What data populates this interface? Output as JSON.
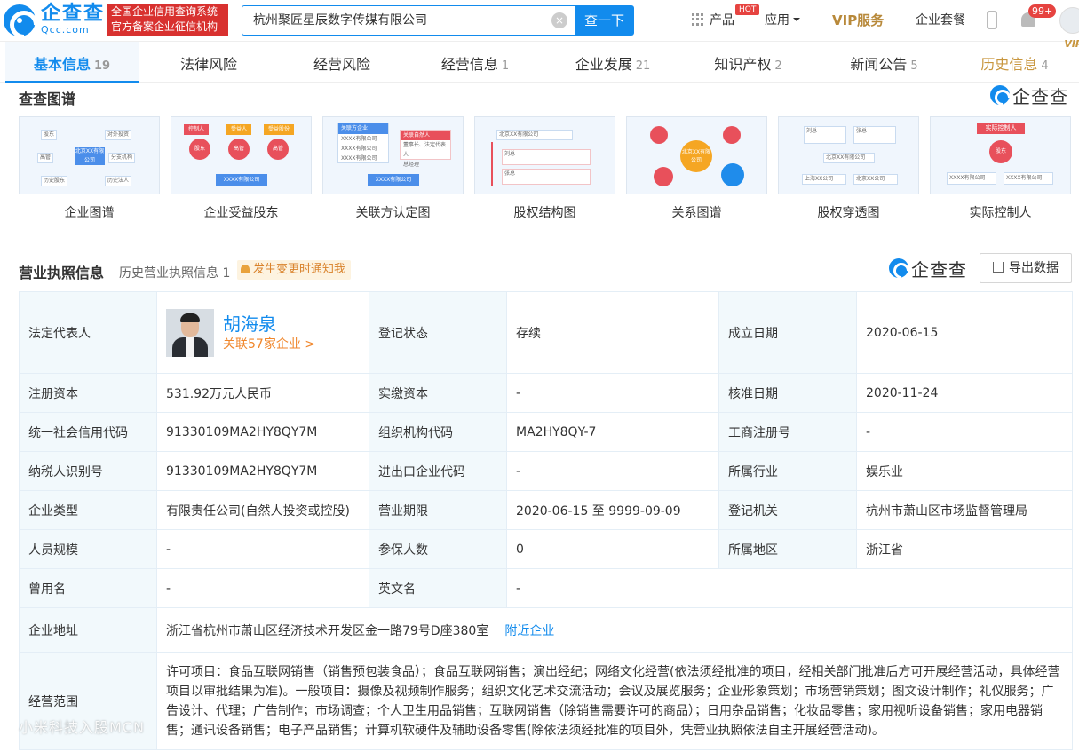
{
  "header": {
    "logo_cn": "企查查",
    "logo_en": "Qcc.com",
    "slogan_line1": "全国企业信用查询系统",
    "slogan_line2": "官方备案企业征信机构",
    "search_value": "杭州聚匠星辰数字传媒有限公司",
    "search_button": "查一下",
    "product": "产品",
    "hot": "HOT",
    "apps": "应用",
    "vip": "VIP服务",
    "package": "企业套餐",
    "notif_count": "99+"
  },
  "tabs": [
    {
      "label": "基本信息",
      "count": "19"
    },
    {
      "label": "法律风险",
      "count": ""
    },
    {
      "label": "经营风险",
      "count": ""
    },
    {
      "label": "经营信息",
      "count": "1"
    },
    {
      "label": "企业发展",
      "count": "21"
    },
    {
      "label": "知识产权",
      "count": "2"
    },
    {
      "label": "新闻公告",
      "count": "5"
    },
    {
      "label": "历史信息",
      "count": "4",
      "tag": "VIP"
    }
  ],
  "graph_section": {
    "title": "查查图谱",
    "brand": "企查查",
    "cards": [
      "企业图谱",
      "企业受益股东",
      "关联方认定图",
      "股权结构图",
      "关系图谱",
      "股权穿透图",
      "实际控制人"
    ],
    "card1": {
      "items": [
        "股东",
        "对外投资",
        "高管",
        "分支机构",
        "历史股东",
        "历史法人"
      ],
      "center": "北京XX有限公司"
    },
    "card2": {
      "tags": [
        "控制人",
        "受益人",
        "受益股份"
      ],
      "nodes": [
        "股东",
        "高管",
        "高管"
      ],
      "bottom": "XXXX有限公司"
    },
    "card3": {
      "left_title": "关联方企业",
      "left_items": [
        "XXXX有限公司",
        "XXXX有限公司",
        "XXXX有限公司"
      ],
      "right_title": "关联自然人",
      "right_items": [
        "董事长、法定代表人",
        "总经理"
      ],
      "bottom": "XXXX有限公司"
    },
    "card4": {
      "title": "北京XX有限公司",
      "rows": [
        "刘总",
        "张总"
      ]
    },
    "card5": {
      "center": "北京XX有限公司"
    },
    "card6": {
      "people": [
        "刘总",
        "张总"
      ],
      "center": "北京XX有限公司",
      "subs": [
        "上海XX公司",
        "北京XX公司"
      ]
    },
    "card7": {
      "title": "实际控制人",
      "node": "股东",
      "subs": [
        "XXXX有限公司",
        "XXXX有限公司"
      ]
    }
  },
  "license_section": {
    "title": "营业执照信息",
    "history_link": "历史营业执照信息 1",
    "notify": "发生变更时通知我",
    "brand": "企查查",
    "export": "导出数据"
  },
  "info": {
    "legal_rep_label": "法定代表人",
    "legal_rep_name": "胡海泉",
    "legal_rep_related": "关联57家企业 >",
    "reg_status_label": "登记状态",
    "reg_status": "存续",
    "found_date_label": "成立日期",
    "found_date": "2020-06-15",
    "reg_capital_label": "注册资本",
    "reg_capital": "531.92万元人民币",
    "paid_capital_label": "实缴资本",
    "paid_capital": "-",
    "approve_date_label": "核准日期",
    "approve_date": "2020-11-24",
    "credit_code_label": "统一社会信用代码",
    "credit_code": "91330109MA2HY8QY7M",
    "org_code_label": "组织机构代码",
    "org_code": "MA2HY8QY-7",
    "biz_reg_label": "工商注册号",
    "biz_reg": "-",
    "tax_id_label": "纳税人识别号",
    "tax_id": "91330109MA2HY8QY7M",
    "ie_code_label": "进出口企业代码",
    "ie_code": "-",
    "industry_label": "所属行业",
    "industry": "娱乐业",
    "type_label": "企业类型",
    "type": "有限责任公司(自然人投资或控股)",
    "term_label": "营业期限",
    "term": "2020-06-15 至 9999-09-09",
    "authority_label": "登记机关",
    "authority": "杭州市萧山区市场监督管理局",
    "staff_label": "人员规模",
    "staff": "-",
    "insured_label": "参保人数",
    "insured": "0",
    "region_label": "所属地区",
    "region": "浙江省",
    "former_name_label": "曾用名",
    "former_name": "-",
    "en_name_label": "英文名",
    "en_name": "-",
    "address_label": "企业地址",
    "address": "浙江省杭州市萧山区经济技术开发区金一路79号D座380室",
    "nearby": "附近企业",
    "scope_label": "经营范围",
    "scope": "许可项目：食品互联网销售（销售预包装食品）；食品互联网销售；演出经纪；网络文化经营(依法须经批准的项目，经相关部门批准后方可开展经营活动，具体经营项目以审批结果为准)。一般项目：摄像及视频制作服务；组织文化艺术交流活动；会议及展览服务；企业形象策划；市场营销策划；图文设计制作；礼仪服务；广告设计、代理；广告制作；市场调查；个人卫生用品销售；互联网销售（除销售需要许可的商品）；日用杂品销售；化妆品零售；家用视听设备销售；家用电器销售；通讯设备销售；电子产品销售；计算机软硬件及辅助设备零售(除依法须经批准的项目外，凭营业执照依法自主开展经营活动)。"
  },
  "watermark": "小米科技入股MCN"
}
